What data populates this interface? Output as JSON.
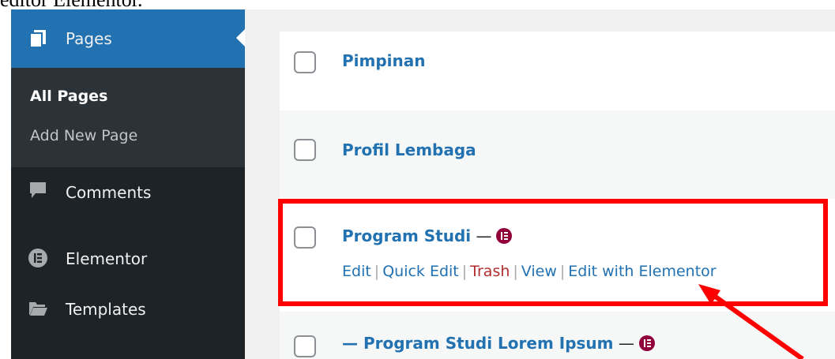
{
  "caption": "editor Elementor.",
  "sidebar": {
    "pages_label": "Pages",
    "submenu": {
      "all_pages": "All Pages",
      "add_new": "Add New Page"
    },
    "comments_label": "Comments",
    "elementor_label": "Elementor",
    "templates_label": "Templates"
  },
  "pages": [
    {
      "title": "Pimpinan"
    },
    {
      "title": "Profil Lembaga"
    },
    {
      "title": "Program Studi",
      "state_sep": " —",
      "actions": {
        "edit": "Edit",
        "quick_edit": "Quick Edit",
        "trash": "Trash",
        "view": "View",
        "edit_with_elementor": "Edit with Elementor",
        "separator": "|"
      }
    },
    {
      "title": "— Program Studi Lorem Ipsum",
      "state_sep": " —"
    }
  ],
  "colors": {
    "admin_blue": "#2271b1",
    "sidebar_dark": "#1d2327",
    "elementor_badge": "#92003b",
    "annotation_red": "#ff0000"
  }
}
